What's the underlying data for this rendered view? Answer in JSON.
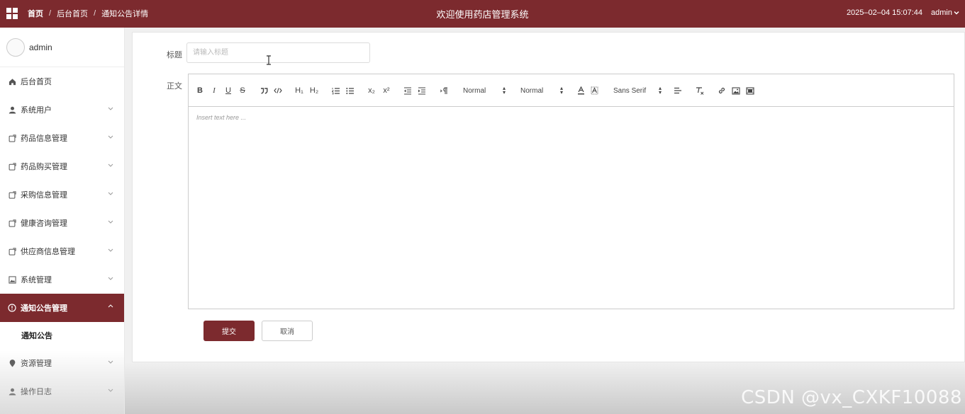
{
  "header": {
    "breadcrumb": [
      "首页",
      "后台首页",
      "通知公告详情"
    ],
    "title": "欢迎使用药店管理系统",
    "datetime": "2025–02–04 15:07:44",
    "user": "admin"
  },
  "sidebar": {
    "user_name": "admin",
    "items": [
      {
        "label": "后台首页",
        "icon": "home-icon"
      },
      {
        "label": "系统用户",
        "icon": "user-icon"
      },
      {
        "label": "药品信息管理",
        "icon": "box-icon"
      },
      {
        "label": "药品购买管理",
        "icon": "box-icon"
      },
      {
        "label": "采购信息管理",
        "icon": "box-icon"
      },
      {
        "label": "健康咨询管理",
        "icon": "box-icon"
      },
      {
        "label": "供应商信息管理",
        "icon": "box-icon"
      },
      {
        "label": "系统管理",
        "icon": "image-icon"
      },
      {
        "label": "通知公告管理",
        "icon": "info-circle-icon"
      },
      {
        "label": "资源管理",
        "icon": "location-pin-icon"
      },
      {
        "label": "操作日志",
        "icon": "user-icon"
      }
    ],
    "sub_item": "通知公告"
  },
  "form": {
    "title_label": "标题",
    "title_placeholder": "请输入标题",
    "body_label": "正文",
    "editor_placeholder": "Insert text here ...",
    "toolbar": {
      "bold": "B",
      "italic": "I",
      "underline": "U",
      "strike": "S",
      "h1": "H₁",
      "h2": "H₂",
      "sub": "x₂",
      "sup": "x²",
      "size_select": "Normal",
      "header_select": "Normal",
      "font_select": "Sans Serif"
    },
    "submit_label": "提交",
    "cancel_label": "取消"
  },
  "watermark": "CSDN @vx_CXKF10088",
  "colors": {
    "primary": "#7c2a2e"
  }
}
